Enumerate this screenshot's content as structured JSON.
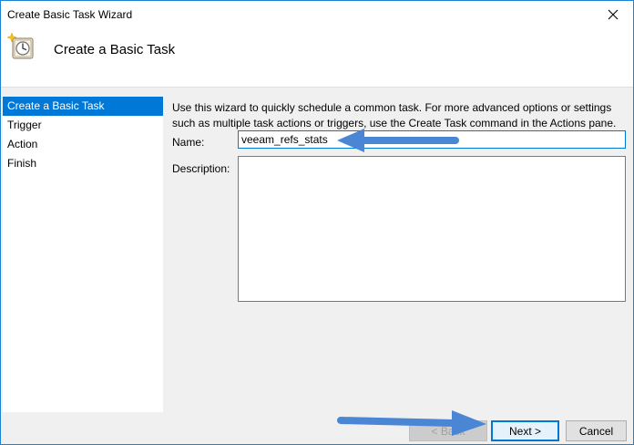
{
  "window": {
    "title": "Create Basic Task Wizard",
    "close_glyph": "✕"
  },
  "header": {
    "title": "Create a Basic Task",
    "icon": "task-scheduler-clock-icon"
  },
  "sidebar": {
    "items": [
      {
        "label": "Create a Basic Task",
        "active": true
      },
      {
        "label": "Trigger",
        "active": false
      },
      {
        "label": "Action",
        "active": false
      },
      {
        "label": "Finish",
        "active": false
      }
    ]
  },
  "main": {
    "intro": "Use this wizard to quickly schedule a common task.  For more advanced options or settings such as multiple task actions or triggers, use the Create Task command in the Actions pane.",
    "name_label": "Name:",
    "name_value": "veeam_refs_stats",
    "description_label": "Description:",
    "description_value": ""
  },
  "buttons": {
    "back": "< Back",
    "next": "Next >",
    "cancel": "Cancel"
  },
  "colors": {
    "accent": "#0078d7",
    "annotation_arrow": "#4a86d4",
    "window_border": "#1883d7"
  }
}
